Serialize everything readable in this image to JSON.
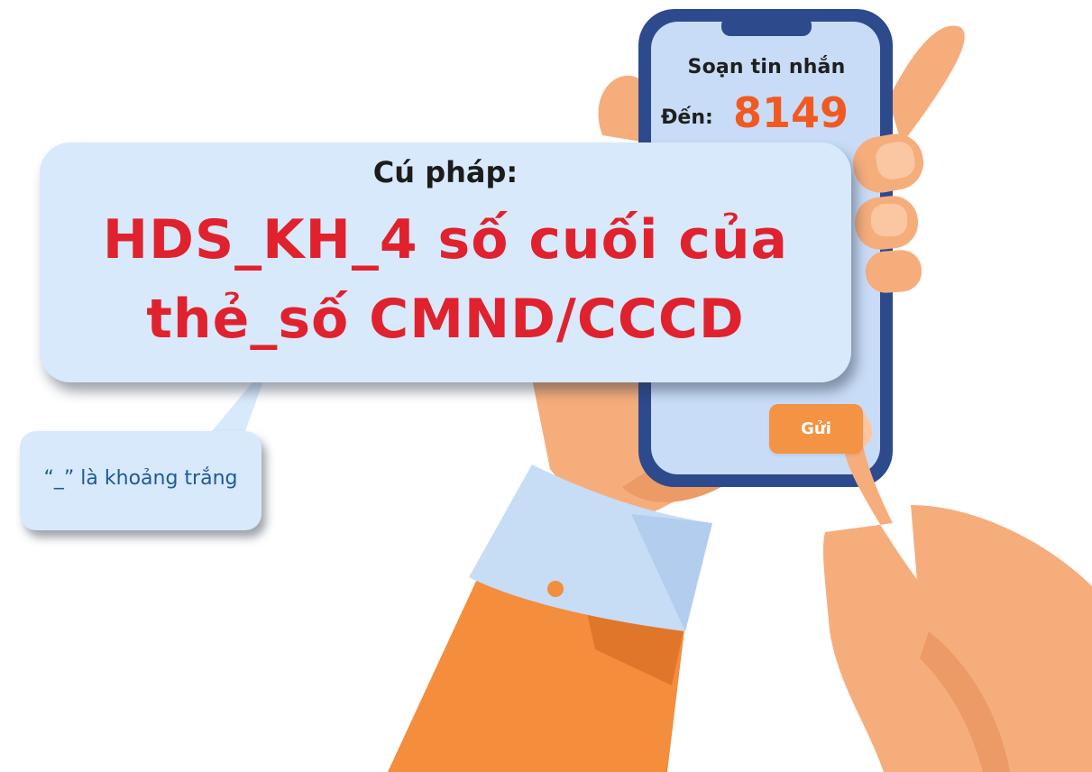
{
  "phone": {
    "title": "Soạn tin nhắn",
    "to_label": "Đến:",
    "to_number": "8149",
    "send_label": "Gửi"
  },
  "bubble": {
    "heading": "Cú pháp:",
    "syntax_line1": "HDS_KH_4 số cuối của",
    "syntax_line2": "thẻ_số CMND/CCCD"
  },
  "note": {
    "text": "“_” là khoảng trắng"
  },
  "colors": {
    "accent_red": "#e0222e",
    "number_orange": "#f05a22",
    "button_orange": "#f39343",
    "bubble_blue": "#d8e9fb",
    "phone_frame": "#2d4a8d",
    "phone_screen": "#c9dcf7",
    "skin": "#f7b07f",
    "sleeve_orange": "#f48d3c",
    "cuff_blue": "#c7dcf5"
  }
}
